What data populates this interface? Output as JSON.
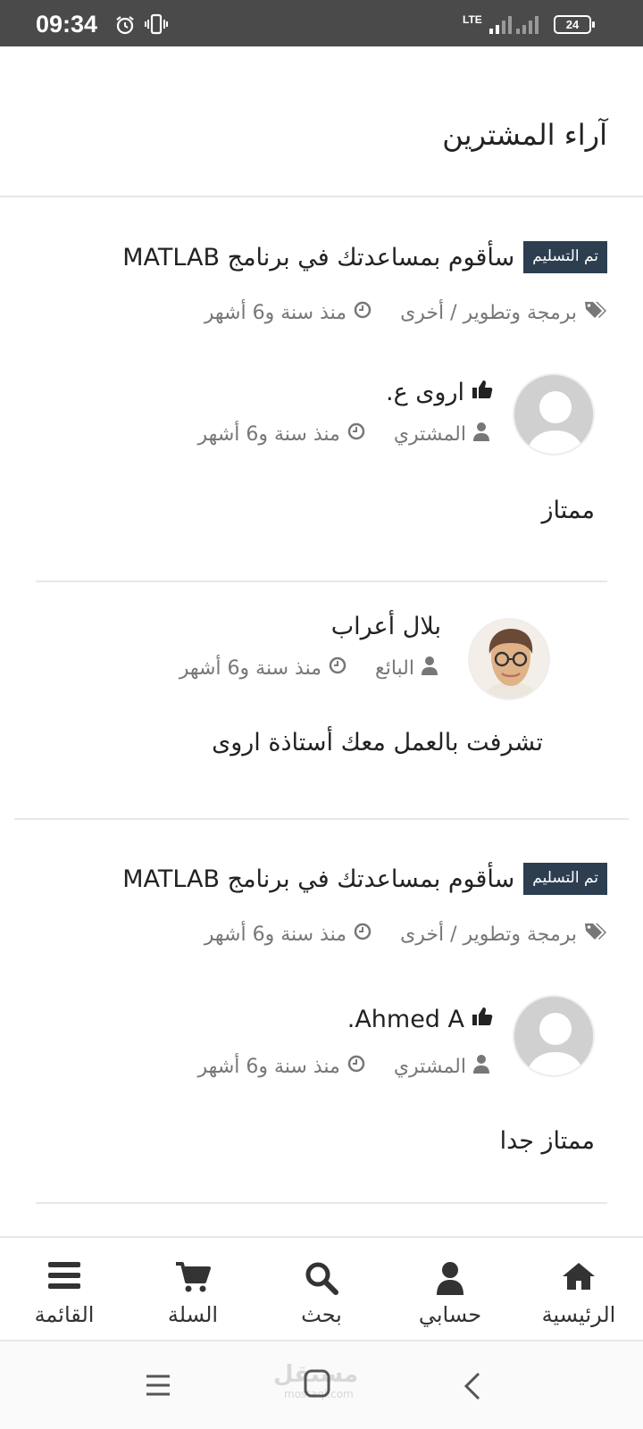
{
  "status_bar": {
    "time": "09:34",
    "network": "LTE",
    "battery": "24"
  },
  "page_title": "آراء المشترين",
  "projects": [
    {
      "badge": "تم التسليم",
      "title": "سأقوم بمساعدتك في برنامج MATLAB",
      "category": "برمجة وتطوير / أخرى",
      "time": "منذ سنة و6 أشهر",
      "review": {
        "name": "اروى ع.",
        "role": "المشتري",
        "time": "منذ سنة و6 أشهر",
        "text": "ممتاز"
      },
      "reply": {
        "name": "بلال أعراب",
        "role": "البائع",
        "time": "منذ سنة و6 أشهر",
        "text": "تشرفت بالعمل معك أستاذة اروى"
      }
    },
    {
      "badge": "تم التسليم",
      "title": "سأقوم بمساعدتك في برنامج MATLAB",
      "category": "برمجة وتطوير / أخرى",
      "time": "منذ سنة و6 أشهر",
      "review": {
        "name": "Ahmed A.",
        "role": "المشتري",
        "time": "منذ سنة و6 أشهر",
        "text": "ممتاز جدا"
      }
    }
  ],
  "bottom_nav": {
    "home": "الرئيسية",
    "account": "حسابي",
    "search": "بحث",
    "cart": "السلة",
    "menu": "القائمة"
  },
  "watermark": {
    "logo": "مستقل",
    "domain": "mostaql.com"
  },
  "colors": {
    "badge_bg": "#2d3e50",
    "status_bar_bg": "#4a4a4a",
    "meta_text": "#777777"
  }
}
